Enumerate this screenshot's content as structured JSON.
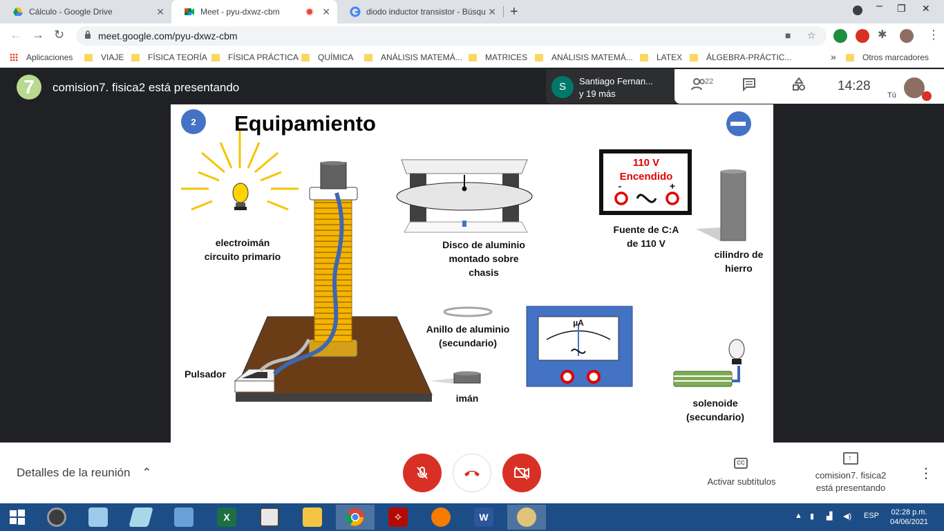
{
  "browser": {
    "tabs": [
      {
        "label": "Cálculo - Google Drive",
        "active": false
      },
      {
        "label": "Meet - pyu-dxwz-cbm",
        "active": true
      },
      {
        "label": "diodo inductor transistor - Búsqu",
        "active": false
      }
    ],
    "url": "meet.google.com/pyu-dxwz-cbm",
    "bookmarks": [
      "Aplicaciones",
      "VIAJE",
      "FÍSICA TEORÍA",
      "FÍSICA PRÁCTICA",
      "QUÍMICA",
      "ANÁLISIS MATEMÁ...",
      "MATRICES",
      "ANÁLISIS MATEMÁ...",
      "LATEX",
      "ÁLGEBRA-PRÁCTIC..."
    ],
    "other_bookmarks": "Otros marcadores",
    "overflow": "»"
  },
  "meet": {
    "presenting": "comision7. fisica2 está presentando",
    "presenter_initial": "7",
    "participant_initial": "S",
    "participant_name": "Santiago Fernan...",
    "participant_more": "y 19 más",
    "participant_count": "22",
    "time": "14:28",
    "self_label": "Tú"
  },
  "slide": {
    "number": "2",
    "title": "Equipamiento",
    "labels": {
      "electroiman": [
        "electroimán",
        "circuito primario"
      ],
      "disco": [
        "Disco de aluminio",
        "montado sobre",
        "chasis"
      ],
      "fuente": [
        "Fuente de C:A",
        "de 110 V"
      ],
      "cilindro": [
        "cilindro de",
        "hierro"
      ],
      "anillo": [
        "Anillo de aluminio",
        "(secundario)"
      ],
      "pulsador": "Pulsador",
      "iman": "imán",
      "solenoide": [
        "solenoide",
        "(secundario)"
      ]
    },
    "source_display": {
      "voltage": "110 V",
      "state": "Encendido",
      "minus": "-",
      "plus": "+"
    },
    "meter_unit": "µA"
  },
  "controls": {
    "details": "Detalles de la reunión",
    "captions": "Activar subtítulos",
    "presenting_line1": "comision7. fisica2",
    "presenting_line2": "está presentando"
  },
  "taskbar": {
    "lang": "ESP",
    "time": "02:28 p.m.",
    "date": "04/06/2021"
  },
  "colors": {
    "tabstrip": "#dee1e6",
    "meet_bg": "#202124",
    "end_call_red": "#d93025",
    "taskbar": "#1c4d87",
    "slide_accent": "#4472c4"
  }
}
